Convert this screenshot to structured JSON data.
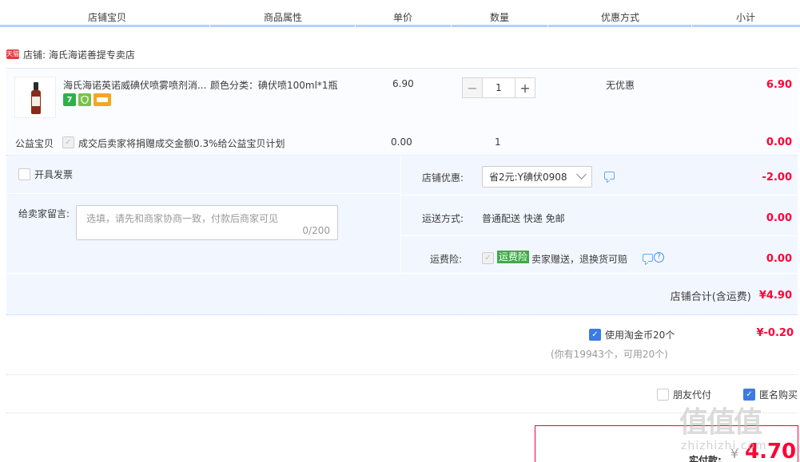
{
  "header": {
    "columns": [
      "店铺宝贝",
      "商品属性",
      "单价",
      "数量",
      "优惠方式",
      "小计"
    ]
  },
  "shop": {
    "badge": "天猫",
    "label": "店铺: 海氏海诺善提专卖店"
  },
  "item": {
    "title": "海氏海诺英诺威碘伏喷雾喷剂消...",
    "attr": "颜色分类：碘伏喷100ml*1瓶",
    "price": "6.90",
    "quantity": "1",
    "discount": "无优惠",
    "subtotal": "6.90",
    "icons": [
      "7-day-return-icon",
      "guarantee-icon",
      "credit-card-icon"
    ]
  },
  "charity": {
    "label": "公益宝贝",
    "text": "成交后卖家将捐赠成交金额0.3%给公益宝贝计划",
    "price": "0.00",
    "quantity": "1",
    "subtotal": "0.00"
  },
  "options": {
    "invoice_label": "开具发票",
    "message_label": "给卖家留言:",
    "message_placeholder": "选填，请先和商家协商一致，付款后商家可见",
    "message_count": "0/200",
    "shop_discount_label": "店铺优惠:",
    "shop_discount_value": "省2元:Y碘伏0908",
    "shop_discount_amount": "-2.00",
    "shipping_label": "运送方式:",
    "shipping_value": "普通配送 快递 免邮",
    "shipping_amount": "0.00",
    "insurance_label": "运费险:",
    "insurance_badge": "运费险",
    "insurance_text": "卖家赠送，退换货可赔",
    "insurance_amount": "0.00",
    "shop_total_label": "店铺合计(含运费)",
    "shop_total_value": "¥4.90"
  },
  "coins": {
    "label": "使用淘金币20个",
    "amount": "¥-0.20",
    "note": "(你有19943个，可用20个)"
  },
  "extras": {
    "friend_pay": "朋友代付",
    "anonymous": "匿名购买"
  },
  "payment": {
    "label": "实付款:",
    "currency": "¥",
    "amount": "4.70"
  },
  "watermark": {
    "top": "值值值",
    "bottom": "zhizhizhi.com"
  },
  "colors": {
    "accent_red": "#ff0036",
    "header_line": "#b2d1ff",
    "panel_bg": "#f2f7ff",
    "checkbox_blue": "#3d7be2",
    "insurance_green": "#3fa94a"
  }
}
